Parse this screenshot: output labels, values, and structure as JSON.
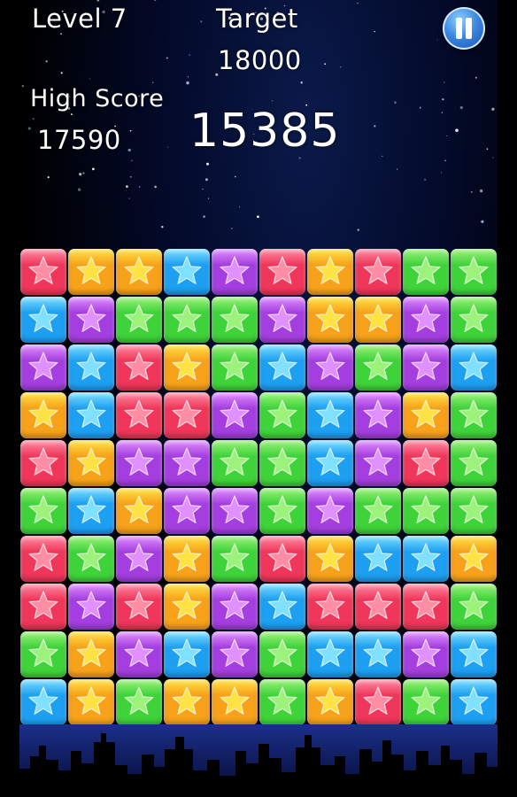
{
  "hud": {
    "level": "Level 7",
    "target_label": "Target",
    "target_value": "18000",
    "high_score_label": "High Score",
    "high_score_value": "17590",
    "score": "15385"
  },
  "colors": {
    "r": {
      "fill": "#f0365a",
      "star": "#ff8ea5"
    },
    "o": {
      "fill": "#f7a21a",
      "star": "#ffe244"
    },
    "b": {
      "fill": "#1d9ff2",
      "star": "#7fe0ff"
    },
    "p": {
      "fill": "#a43ee0",
      "star": "#e190ff"
    },
    "g": {
      "fill": "#3fd33a",
      "star": "#9cf27a"
    }
  },
  "board": {
    "rows": [
      [
        "r",
        "o",
        "o",
        "b",
        "p",
        "r",
        "o",
        "r",
        "g",
        "g"
      ],
      [
        "b",
        "p",
        "g",
        "g",
        "g",
        "p",
        "o",
        "o",
        "p",
        "g"
      ],
      [
        "p",
        "b",
        "r",
        "o",
        "g",
        "b",
        "p",
        "g",
        "p",
        "b"
      ],
      [
        "o",
        "b",
        "r",
        "r",
        "p",
        "g",
        "b",
        "p",
        "o",
        "g"
      ],
      [
        "r",
        "o",
        "p",
        "p",
        "g",
        "g",
        "b",
        "p",
        "r",
        "g"
      ],
      [
        "g",
        "b",
        "o",
        "p",
        "p",
        "g",
        "p",
        "g",
        "g",
        "g"
      ],
      [
        "r",
        "g",
        "p",
        "o",
        "g",
        "r",
        "o",
        "b",
        "b",
        "o"
      ],
      [
        "r",
        "p",
        "r",
        "o",
        "p",
        "b",
        "r",
        "r",
        "r",
        "g"
      ],
      [
        "g",
        "o",
        "p",
        "b",
        "p",
        "g",
        "b",
        "b",
        "p",
        "b"
      ],
      [
        "b",
        "o",
        "g",
        "o",
        "o",
        "g",
        "o",
        "r",
        "g",
        "b"
      ]
    ]
  }
}
